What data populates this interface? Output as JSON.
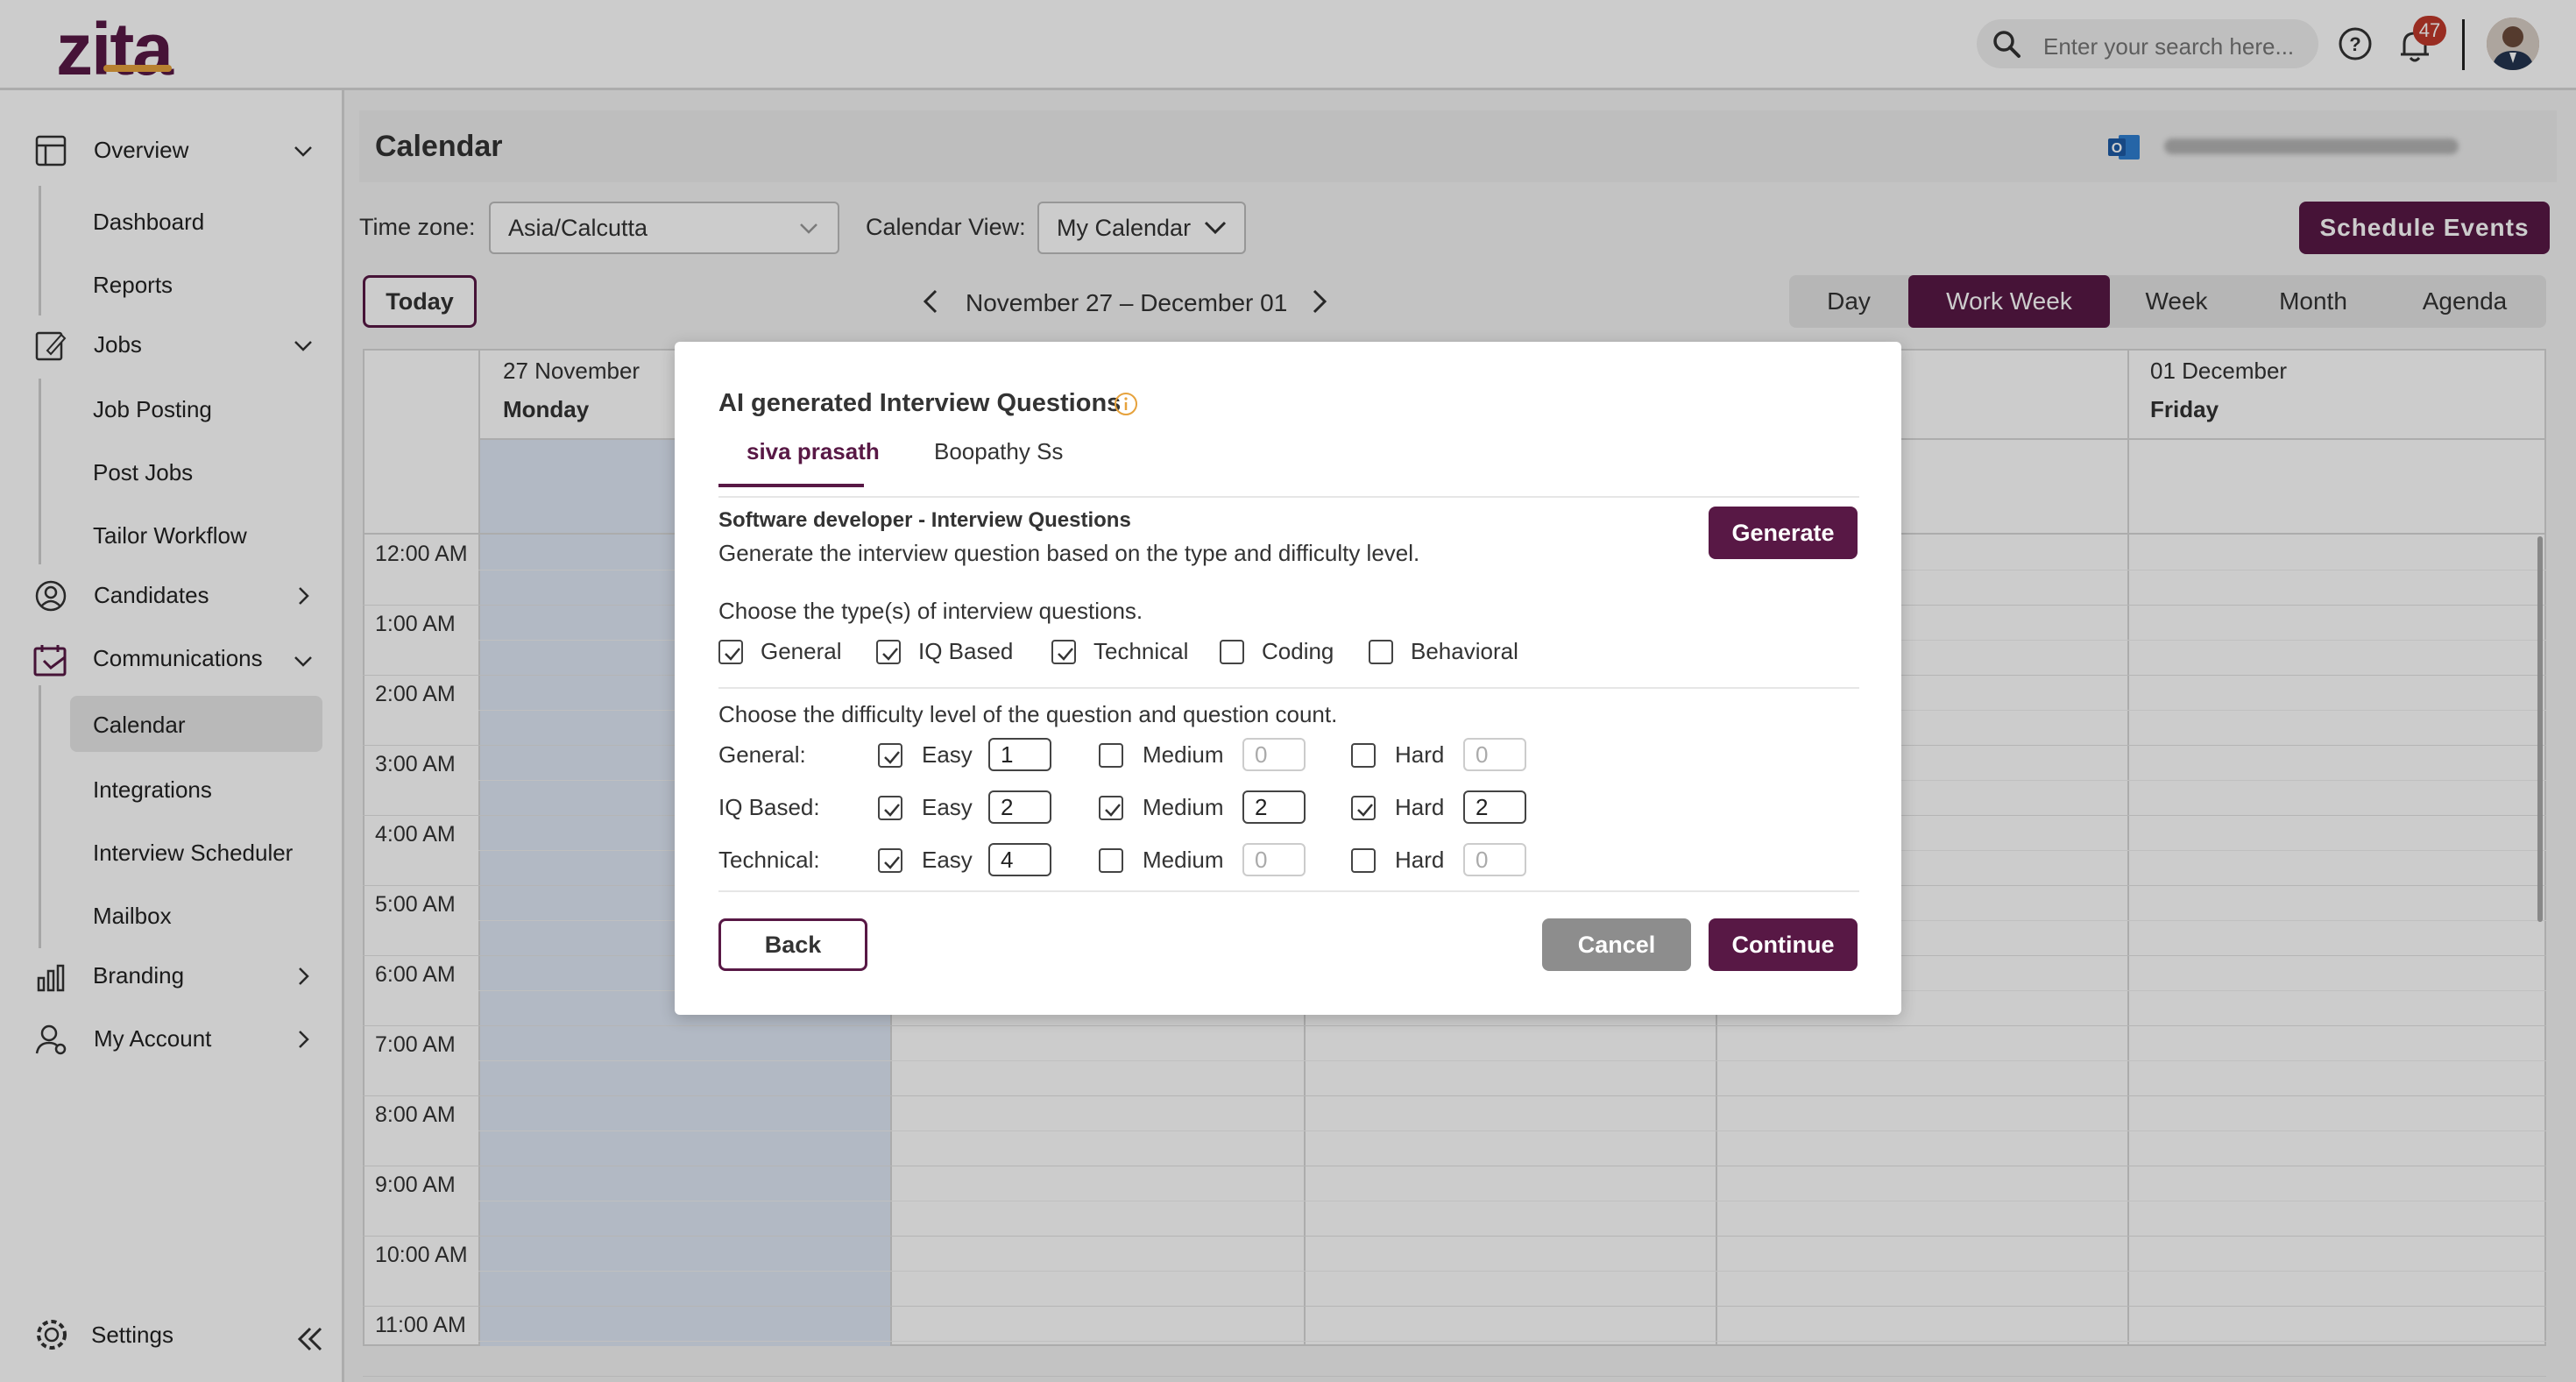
{
  "header": {
    "logo_text": "zita",
    "search_placeholder": "Enter your search here...",
    "notification_count": "47"
  },
  "sidebar": {
    "items": [
      {
        "label": "Overview"
      },
      {
        "label": "Dashboard"
      },
      {
        "label": "Reports"
      },
      {
        "label": "Jobs"
      },
      {
        "label": "Job Posting"
      },
      {
        "label": "Post Jobs"
      },
      {
        "label": "Tailor Workflow"
      },
      {
        "label": "Candidates"
      },
      {
        "label": "Communications"
      },
      {
        "label": "Calendar"
      },
      {
        "label": "Integrations"
      },
      {
        "label": "Interview Scheduler"
      },
      {
        "label": "Mailbox"
      },
      {
        "label": "Branding"
      },
      {
        "label": "My Account"
      },
      {
        "label": "Settings"
      }
    ]
  },
  "calendar": {
    "title": "Calendar",
    "timezone_label": "Time zone:",
    "timezone_value": "Asia/Calcutta",
    "view_label": "Calendar View:",
    "view_value": "My Calendar",
    "schedule_button": "Schedule Events",
    "today_button": "Today",
    "date_range": "November 27 – December 01",
    "view_tabs": [
      "Day",
      "Work Week",
      "Week",
      "Month",
      "Agenda"
    ],
    "active_view": "Work Week",
    "days": [
      {
        "date": "27 November",
        "name": "Monday"
      },
      {
        "date": "01 December",
        "name": "Friday"
      }
    ],
    "times": [
      "12:00 AM",
      "1:00 AM",
      "2:00 AM",
      "3:00 AM",
      "4:00 AM",
      "5:00 AM",
      "6:00 AM",
      "7:00 AM",
      "8:00 AM",
      "9:00 AM",
      "10:00 AM",
      "11:00 AM"
    ]
  },
  "modal": {
    "title": "AI generated Interview Questions",
    "tabs": [
      "siva prasath",
      "Boopathy Ss"
    ],
    "job_title": "Software developer - Interview Questions",
    "description": "Generate the interview question based on the type and difficulty level.",
    "generate_button": "Generate",
    "types_prompt": "Choose the type(s) of interview questions.",
    "types": [
      {
        "label": "General",
        "checked": true
      },
      {
        "label": "IQ Based",
        "checked": true
      },
      {
        "label": "Technical",
        "checked": true
      },
      {
        "label": "Coding",
        "checked": false
      },
      {
        "label": "Behavioral",
        "checked": false
      }
    ],
    "difficulty_prompt": "Choose the difficulty level of the question and question count.",
    "levels": [
      "Easy",
      "Medium",
      "Hard"
    ],
    "rows": [
      {
        "label": "General:",
        "easy": {
          "checked": true,
          "count": "1"
        },
        "medium": {
          "checked": false,
          "count": "0"
        },
        "hard": {
          "checked": false,
          "count": "0"
        }
      },
      {
        "label": "IQ Based:",
        "easy": {
          "checked": true,
          "count": "2"
        },
        "medium": {
          "checked": true,
          "count": "2"
        },
        "hard": {
          "checked": true,
          "count": "2"
        }
      },
      {
        "label": "Technical:",
        "easy": {
          "checked": true,
          "count": "4"
        },
        "medium": {
          "checked": false,
          "count": "0"
        },
        "hard": {
          "checked": false,
          "count": "0"
        }
      }
    ],
    "back_button": "Back",
    "cancel_button": "Cancel",
    "continue_button": "Continue"
  },
  "colors": {
    "brand": "#581845",
    "accent": "#e6a23c"
  }
}
